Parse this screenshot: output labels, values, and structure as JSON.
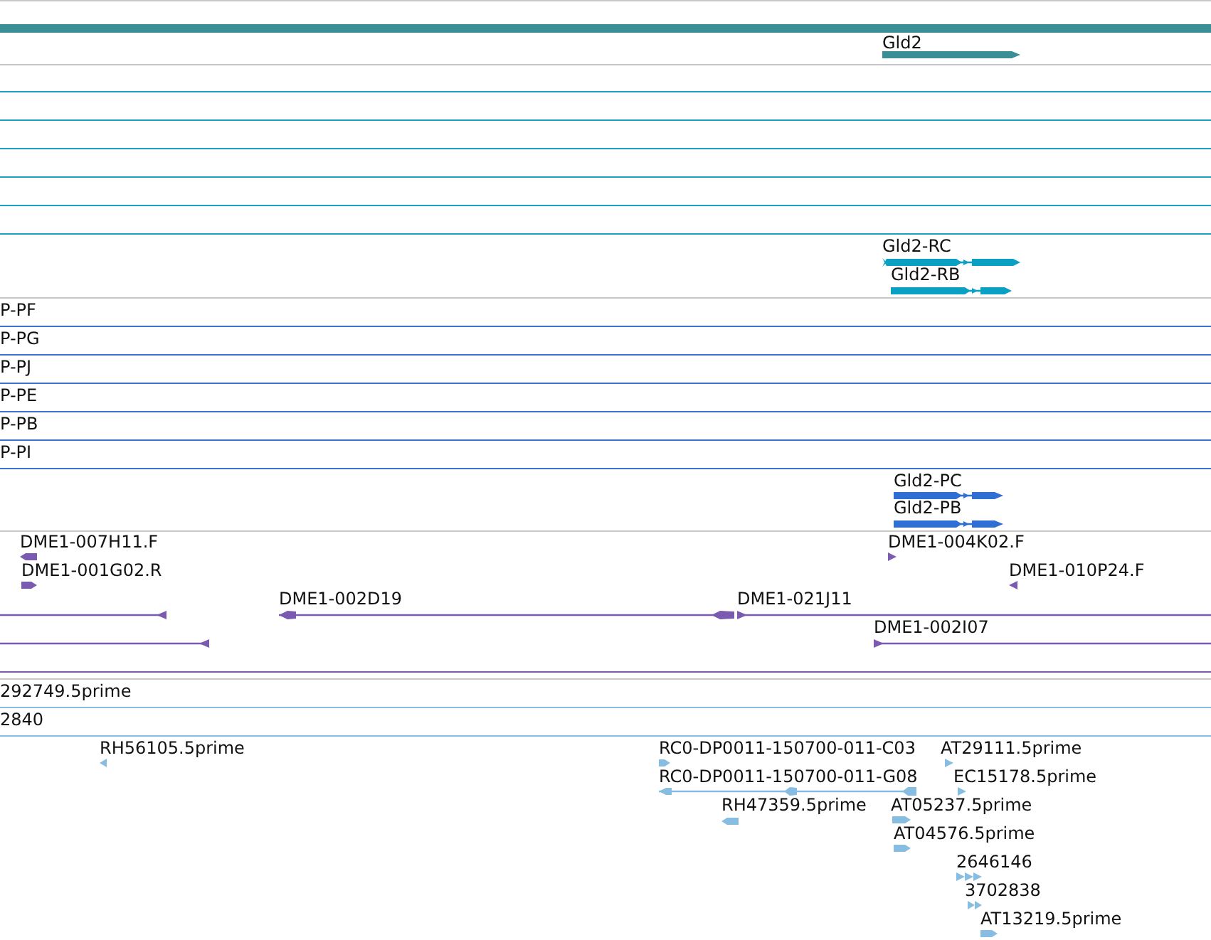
{
  "gene_track": {
    "features": [
      {
        "label": "Gld2"
      }
    ]
  },
  "transcript_track": {
    "features": [
      {
        "label": "Gld2-RC"
      },
      {
        "label": "Gld2-RB"
      }
    ]
  },
  "protein_track": {
    "rows": [
      {
        "label": "P-PF"
      },
      {
        "label": "P-PG"
      },
      {
        "label": "P-PJ"
      },
      {
        "label": "P-PE"
      },
      {
        "label": "P-PB"
      },
      {
        "label": "P-PI"
      }
    ],
    "features": [
      {
        "label": "Gld2-PC"
      },
      {
        "label": "Gld2-PB"
      }
    ]
  },
  "clone_track": {
    "features": [
      {
        "label": "DME1-007H11.F"
      },
      {
        "label": "DME1-001G02.R"
      },
      {
        "label": "DME1-004K02.F"
      },
      {
        "label": "DME1-010P24.F"
      },
      {
        "label": "DME1-002D19"
      },
      {
        "label": "DME1-021J11"
      },
      {
        "label": "DME1-002I07"
      }
    ]
  },
  "est_rows": [
    {
      "label": "292749.5prime"
    },
    {
      "label": "2840"
    }
  ],
  "est_track": {
    "features": [
      {
        "label": "RH56105.5prime"
      },
      {
        "label": "RC0-DP0011-150700-011-C03"
      },
      {
        "label": "AT29111.5prime"
      },
      {
        "label": "RC0-DP0011-150700-011-G08"
      },
      {
        "label": "EC15178.5prime"
      },
      {
        "label": "RH47359.5prime"
      },
      {
        "label": "AT05237.5prime"
      },
      {
        "label": "AT04576.5prime"
      },
      {
        "label": "2646146"
      },
      {
        "label": "3702838"
      },
      {
        "label": "AT13219.5prime"
      }
    ]
  }
}
